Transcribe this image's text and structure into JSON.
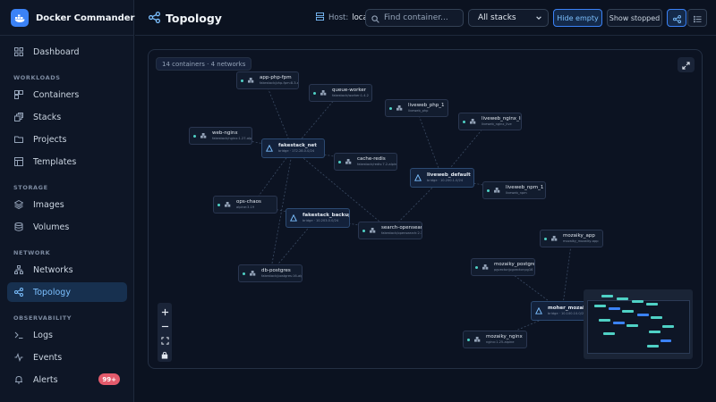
{
  "app": {
    "title": "Docker Commander"
  },
  "sidebar": {
    "dashboard": "Dashboard",
    "sections": {
      "workloads": "WORKLOADS",
      "storage": "STORAGE",
      "network": "NETWORK",
      "observability": "OBSERVABILITY"
    },
    "items": {
      "containers": "Containers",
      "stacks": "Stacks",
      "projects": "Projects",
      "templates": "Templates",
      "images": "Images",
      "volumes": "Volumes",
      "networks": "Networks",
      "topology": "Topology",
      "logs": "Logs",
      "events": "Events",
      "alerts": "Alerts"
    },
    "alerts_badge": "99+",
    "active": "topology"
  },
  "header": {
    "title": "Topology",
    "host_label": "Host:",
    "host_value": "local",
    "search_placeholder": "Find container...",
    "stack_filter": "All stacks",
    "hide_empty": "Hide empty",
    "show_stopped": "Show stopped"
  },
  "canvas": {
    "status": "14 containers · 4 networks"
  },
  "nodes": [
    {
      "id": "app-php-fpm",
      "name": "app-php-fpm",
      "sub": "fakestack/php-fpm:8.3-alpine",
      "type": "container"
    },
    {
      "id": "queue-worker",
      "name": "queue-worker",
      "sub": "fakestack/worker:1.4.2",
      "type": "container"
    },
    {
      "id": "web-nginx",
      "name": "web-nginx",
      "sub": "fakestack/nginx:1.27-alpine",
      "type": "container"
    },
    {
      "id": "fakestack-net",
      "name": "fakestack_net",
      "sub": "bridge · 172.28.0.0/24",
      "type": "network"
    },
    {
      "id": "cache-redis",
      "name": "cache-redis",
      "sub": "fakestack/redis:7.2-alpine",
      "type": "container"
    },
    {
      "id": "liveweb-php-1",
      "name": "liveweb_php_1",
      "sub": "liveweb_php",
      "type": "container"
    },
    {
      "id": "liveweb-nginx-live",
      "name": "liveweb_nginx_live...",
      "sub": "liveweb_nginx_live",
      "type": "container"
    },
    {
      "id": "liveweb-default",
      "name": "liveweb_default",
      "sub": "bridge · 10.200.1.0/24",
      "type": "network"
    },
    {
      "id": "liveweb-npm-1",
      "name": "liveweb_npm_1",
      "sub": "liveweb_npm",
      "type": "container"
    },
    {
      "id": "ops-chaos",
      "name": "ops-chaos",
      "sub": "alpine:3.19",
      "type": "container"
    },
    {
      "id": "fakestack-backup",
      "name": "fakestack_backup",
      "sub": "bridge · 10.203.0.0/24",
      "type": "network"
    },
    {
      "id": "search-opensearch",
      "name": "search-opensearch",
      "sub": "fakestack/opensearch:2.13.0",
      "type": "container"
    },
    {
      "id": "db-postgres",
      "name": "db-postgres",
      "sub": "fakestack/postgres:16-alpine",
      "type": "container"
    },
    {
      "id": "mozaiky-app",
      "name": "mozaiky_app",
      "sub": "mozaiky_mozaiky-app",
      "type": "container"
    },
    {
      "id": "mozaiky-postgres",
      "name": "mozaiky_postgres",
      "sub": "pgvector/pgvector:pg16",
      "type": "container"
    },
    {
      "id": "moher-mozaiky-n",
      "name": "moher_mozaiky_n",
      "sub": "bridge · 10.100.10.0/24",
      "type": "network"
    },
    {
      "id": "mozaiky-nginx",
      "name": "mozaiky_nginx",
      "sub": "nginx:1.25-alpine",
      "type": "container"
    }
  ],
  "colors": {
    "accent": "#3b82f6",
    "running": "#4fd1c5",
    "network_node": "#13213a",
    "alert_badge": "#e35a6b"
  },
  "icons": {
    "brand": "docker-whale-icon",
    "container_node": "box-icon",
    "network_node": "network-triangle-icon"
  }
}
